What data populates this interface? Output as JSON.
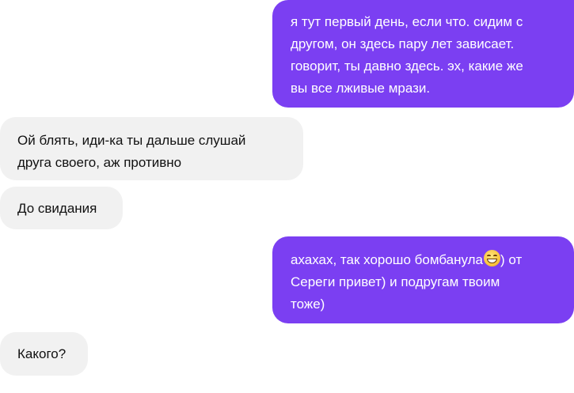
{
  "chat": {
    "messages": [
      {
        "direction": "outgoing",
        "text": "я тут первый день, если что. сидим с\nдругом, он здесь пару лет зависает.\nговорит, ты давно здесь. эх, какие же\nвы все лживые мрази."
      },
      {
        "direction": "incoming",
        "text": "Ой блять, иди-ка ты дальше слушай\nдруга своего, аж противно"
      },
      {
        "direction": "incoming",
        "text": "До свидания"
      },
      {
        "direction": "outgoing",
        "text_before_emoji": "ахахах, так хорошо бомбанула",
        "emoji": "grinning-face-with-smiling-eyes",
        "text_after_emoji": ") от\nСереги привет) и подругам твоим\nтоже)"
      },
      {
        "direction": "incoming",
        "text": "Какого?"
      }
    ]
  },
  "colors": {
    "outgoing_bubble": "#7b3ff2",
    "incoming_bubble": "#f1f1f1",
    "outgoing_text": "#ffffff",
    "incoming_text": "#111111"
  }
}
